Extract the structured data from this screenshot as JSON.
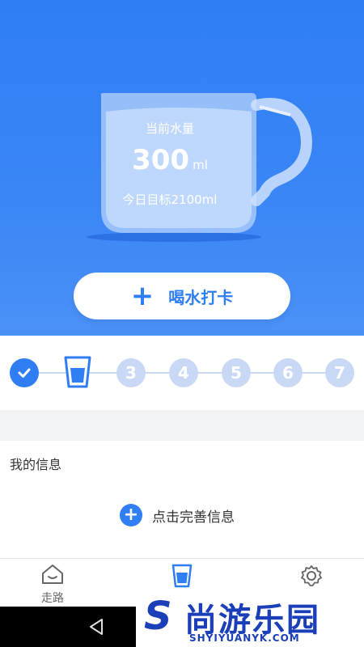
{
  "hero": {
    "current_label": "当前水量",
    "amount": "300",
    "unit": "ml",
    "goal": "今日目标2100ml",
    "checkin_label": "喝水打卡"
  },
  "steps": {
    "items": [
      "3",
      "4",
      "5",
      "6",
      "7"
    ]
  },
  "info": {
    "title": "我的信息",
    "complete_label": "点击完善信息"
  },
  "tabbar": {
    "walk_label": "走路"
  },
  "watermark": {
    "brand": "尚游乐园",
    "url": "SHYIYUANYK.COM"
  },
  "colors": {
    "primary": "#2f7ef4",
    "step_inactive": "#c9d9f5"
  }
}
